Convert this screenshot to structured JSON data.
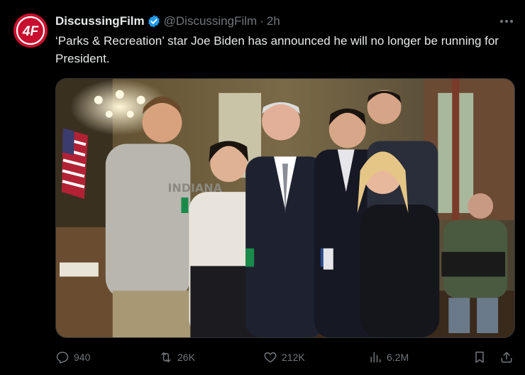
{
  "tweet": {
    "author_name": "DiscussingFilm",
    "author_handle": "@DiscussingFilm",
    "separator": "·",
    "time": "2h",
    "text": "‘Parks & Recreation’ star Joe Biden has announced he will no longer be running for President.",
    "avatar_text": "4F"
  },
  "actions": {
    "replies": "940",
    "retweets": "26K",
    "likes": "212K",
    "views": "6.2M"
  },
  "colors": {
    "background": "#000000",
    "text": "#e7e9ea",
    "muted": "#71767b",
    "verified": "#1d9bf0",
    "avatar": "#c8102e"
  }
}
